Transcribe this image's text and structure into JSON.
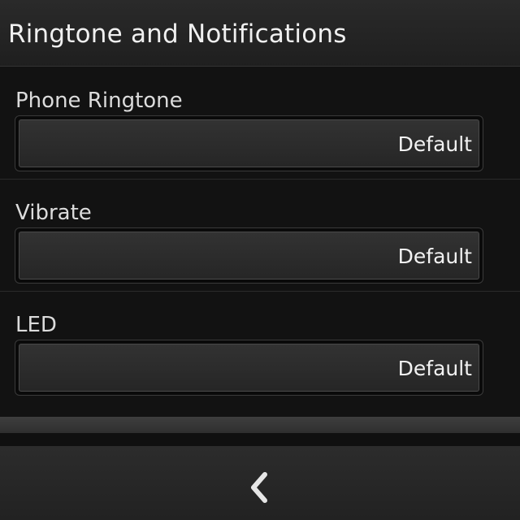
{
  "header": {
    "title": "Ringtone and Notifications"
  },
  "settings": [
    {
      "label": "Phone Ringtone",
      "value": "Default"
    },
    {
      "label": "Vibrate",
      "value": "Default"
    },
    {
      "label": "LED",
      "value": "Default"
    }
  ],
  "action_bar": {
    "back_icon": "chevron-left-icon"
  },
  "colors": {
    "background": "#121212",
    "text": "#e8e8e8",
    "field": "#2c2c2c"
  }
}
